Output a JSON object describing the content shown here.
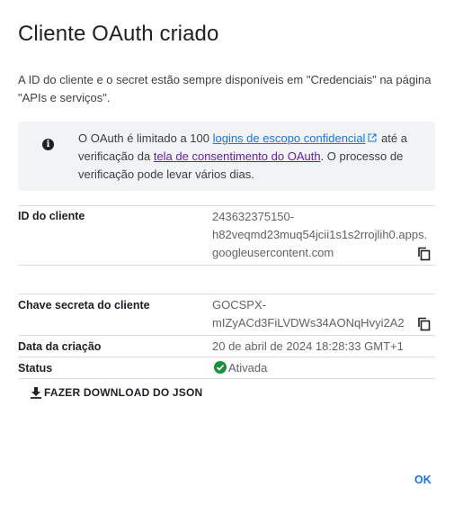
{
  "dialog": {
    "title": "Cliente OAuth criado",
    "intro": "A ID do cliente e o secret estão sempre disponíveis em \"Credenciais\" na página \"APIs e serviços\".",
    "info": {
      "icon": "info-icon",
      "text_before": "O OAuth é limitado a 100 ",
      "link1": "logins de escopo confidencial",
      "text_middle": " até a verificação da ",
      "link2": "tela de consentimento do OAuth",
      "text_after": ". O processo de verificação pode levar vários dias."
    },
    "fields": {
      "client_id": {
        "label": "ID do cliente",
        "line1": "243632375150-",
        "line2": "h82veqmd23muq54jcii1s1s2rrojlih0.apps.",
        "line3": "googleusercontent.com"
      },
      "client_secret": {
        "label": "Chave secreta do cliente",
        "line1": "GOCSPX-",
        "line2": "mIZyACd3FiLVDWs34AONqHvyi2A2"
      },
      "created": {
        "label": "Data da criação",
        "value": "20 de abril de 2024 18:28:33 GMT+1"
      },
      "status": {
        "label": "Status",
        "value": "Ativada",
        "color": "#1e8e3e"
      }
    },
    "download_label": "FAZER DOWNLOAD DO JSON",
    "ok_label": "OK"
  },
  "colors": {
    "accent": "#1a73e8",
    "visited_link": "#681da8",
    "success": "#1e8e3e"
  }
}
